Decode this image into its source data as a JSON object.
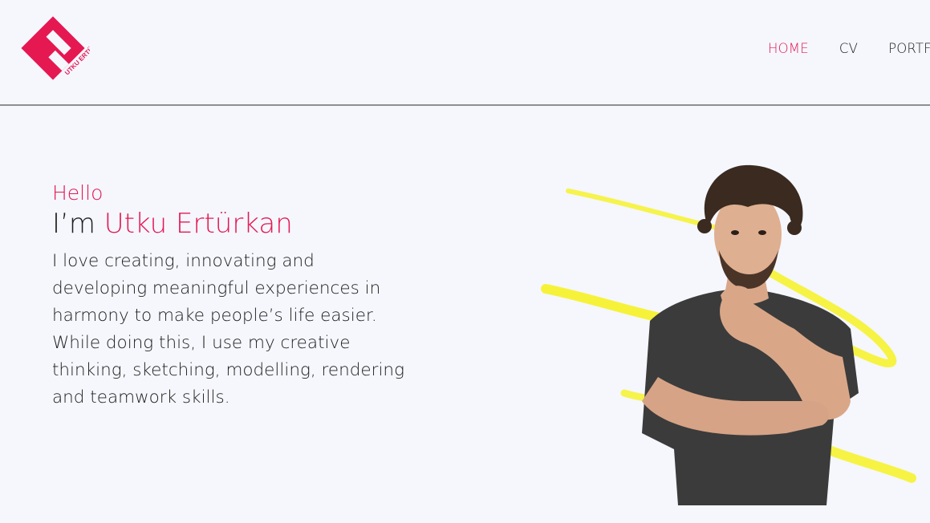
{
  "brand": {
    "logo_text": "UTKU ERTÜRKAN",
    "accent_color": "#e51852"
  },
  "nav": {
    "items": [
      {
        "label": "HOME",
        "active": true
      },
      {
        "label": "CV",
        "active": false
      },
      {
        "label": "PORTFOLIO",
        "active": false
      }
    ]
  },
  "hero": {
    "greeting": "Hello",
    "intro_prefix": "I’m",
    "name": "Utku Ertürkan",
    "bio": "I love creating, innovating and developing meaningful experiences in harmony to make people’s life easier. While doing this, I use my creative thinking, sketching, modelling, rendering and teamwork skills.",
    "scribble_color": "#f6f23a"
  }
}
